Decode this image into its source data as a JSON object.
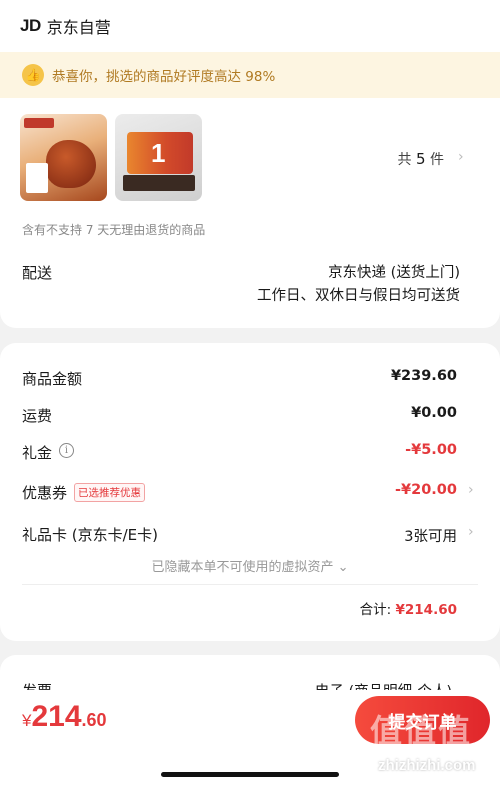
{
  "shop": {
    "logo": "JD",
    "name": "京东自营"
  },
  "praise": {
    "text": "恭喜你，挑选的商品好评度高达 98%"
  },
  "products": {
    "count_prefix": "共",
    "count": "5",
    "count_suffix": "件",
    "no_return_notice": "含有不支持 7 天无理由退货的商品"
  },
  "delivery": {
    "label": "配送",
    "method": "京东快递 (送货上门)",
    "schedule": "工作日、双休日与假日均可送货"
  },
  "fees": {
    "goods_amount_label": "商品金额",
    "goods_amount": "¥239.60",
    "shipping_label": "运费",
    "shipping": "¥0.00",
    "gift_money_label": "礼金",
    "gift_money": "-¥5.00",
    "coupon_label": "优惠券",
    "coupon_badge": "已选推荐优惠",
    "coupon": "-¥20.00",
    "gift_card_label": "礼品卡 (京东卡/E卡)",
    "gift_card_value": "3张可用",
    "hidden_assets": "已隐藏本单不可使用的虚拟资产",
    "total_label": "合计: ",
    "total": "¥214.60"
  },
  "invoice": {
    "label": "发票",
    "value": "电子 (商品明细-个人)"
  },
  "bottom": {
    "currency": "¥",
    "price_int": "214",
    "price_dec": ".60",
    "submit_label": "提交订单"
  },
  "watermark": {
    "text": "zhizhizhi.com",
    "glyphs": "值值值"
  },
  "icons": {
    "thumb": "thumbs-up-icon",
    "info": "info-icon",
    "chevron": "chevron-right-icon",
    "down": "chevron-down-icon"
  },
  "colors": {
    "accent_red": "#e4393c",
    "praise_bg": "#fdf5e1",
    "praise_text": "#b07a22"
  }
}
